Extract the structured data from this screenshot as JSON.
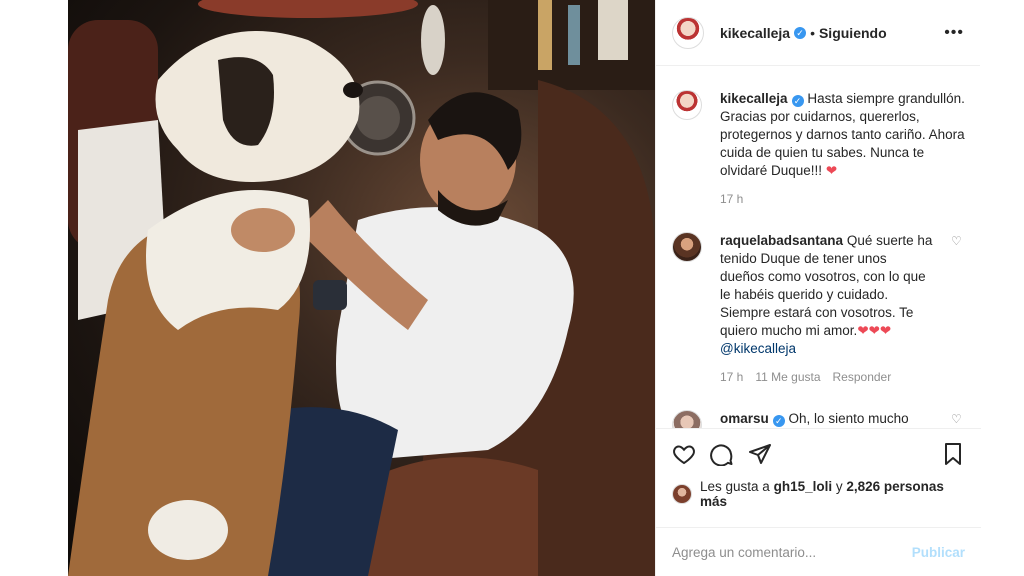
{
  "post": {
    "username": "kikecalleja",
    "follow_status": "Siguiendo",
    "separator": "•",
    "more": "•••"
  },
  "comments": [
    {
      "user": "kikecalleja",
      "text": "Hasta siempre grandullón. Gracias por cuidarnos, quererlos, protegernos y darnos tanto cariño. Ahora cuida de quien tu sabes. Nunca te olvidaré Duque!!!",
      "emoji": "❤",
      "time": "17 h"
    },
    {
      "user": "raquelabadsantana",
      "text": "Qué suerte ha tenido Duque de tener unos dueños como vosotros, con lo que le habéis querido y cuidado. Siempre estará con vosotros. Te quiero mucho mi amor.",
      "emoji": "❤❤❤",
      "mention": "@kikecalleja",
      "time": "17 h",
      "likes": "11 Me gusta",
      "reply": "Responder"
    },
    {
      "user": "omarsu",
      "text": "Oh, lo siento mucho"
    }
  ],
  "likes": {
    "prefix": "Les gusta a",
    "user": "gh15_loli",
    "middle": "y",
    "count": "2,826 personas más"
  },
  "add_comment": {
    "placeholder": "Agrega un comentario...",
    "publish": "Publicar"
  },
  "icons": {
    "like": "heart-icon",
    "comment": "comment-icon",
    "share": "share-icon",
    "save": "bookmark-icon"
  }
}
